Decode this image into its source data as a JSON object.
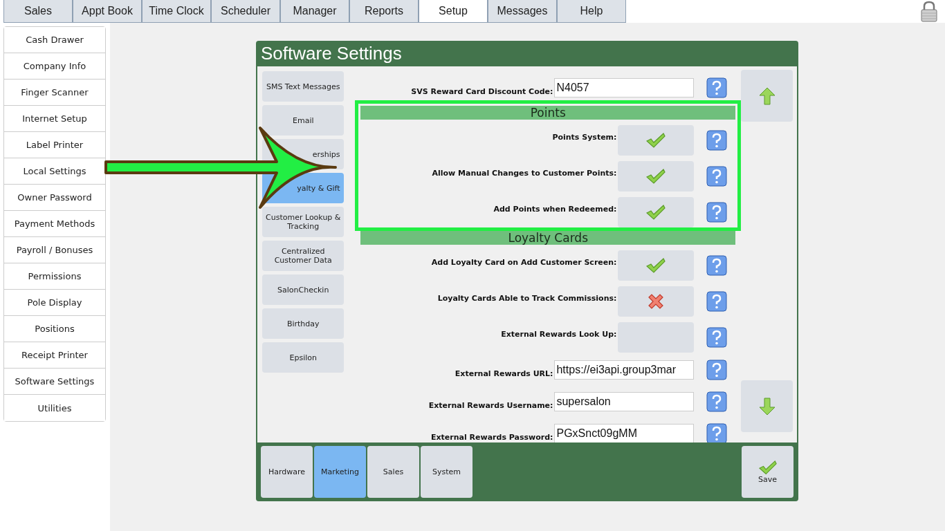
{
  "top_tabs": [
    {
      "label": "Sales",
      "selected": false
    },
    {
      "label": "Appt Book",
      "selected": false
    },
    {
      "label": "Time Clock",
      "selected": false
    },
    {
      "label": "Scheduler",
      "selected": false
    },
    {
      "label": "Manager",
      "selected": false
    },
    {
      "label": "Reports",
      "selected": false
    },
    {
      "label": "Setup",
      "selected": true
    },
    {
      "label": "Messages",
      "selected": false
    },
    {
      "label": "Help",
      "selected": false
    }
  ],
  "sidebar": {
    "items": [
      {
        "label": "Cash Drawer",
        "selected": false
      },
      {
        "label": "Company Info",
        "selected": false
      },
      {
        "label": "Finger Scanner",
        "selected": false
      },
      {
        "label": "Internet Setup",
        "selected": false
      },
      {
        "label": "Label Printer",
        "selected": false
      },
      {
        "label": "Local Settings",
        "selected": false
      },
      {
        "label": "Owner Password",
        "selected": false
      },
      {
        "label": "Payment Methods",
        "selected": false
      },
      {
        "label": "Payroll / Bonuses",
        "selected": false
      },
      {
        "label": "Permissions",
        "selected": false
      },
      {
        "label": "Pole Display",
        "selected": false
      },
      {
        "label": "Positions",
        "selected": false
      },
      {
        "label": "Receipt Printer",
        "selected": false
      },
      {
        "label": "Software Settings",
        "selected": false
      },
      {
        "label": "Utilities",
        "selected": false
      }
    ]
  },
  "dialog": {
    "title": "Software Settings",
    "categories": [
      {
        "label": "SMS Text Messages",
        "selected": false
      },
      {
        "label": "Email",
        "selected": false
      },
      {
        "label": "erships",
        "selected": false,
        "kind": "partial"
      },
      {
        "label": "yalty & Gift",
        "selected": true,
        "kind": "partial"
      },
      {
        "label": "Customer Lookup & Tracking",
        "selected": false
      },
      {
        "label": "Centralized Customer Data",
        "selected": false
      },
      {
        "label": "SalonCheckin",
        "selected": false
      },
      {
        "label": "Birthday",
        "selected": false
      },
      {
        "label": "Epsilon",
        "selected": false
      }
    ],
    "sections": [
      {
        "highlighted": false,
        "rows": [
          {
            "kind": "field",
            "label": "SVS Reward Card Discount Code:",
            "value": "N4057"
          }
        ]
      },
      {
        "heading": "Points",
        "highlighted": true,
        "rows": [
          {
            "kind": "toggle",
            "label": "Points System:",
            "checked": true
          },
          {
            "kind": "toggle",
            "label": "Allow Manual Changes to Customer Points:",
            "checked": true
          },
          {
            "kind": "toggle",
            "label": "Add Points when Redeemed:",
            "checked": true
          }
        ]
      },
      {
        "heading": "Loyalty Cards",
        "highlighted": false,
        "rows": [
          {
            "kind": "toggle",
            "label": "Add Loyalty Card on Add Customer Screen:",
            "checked": true
          },
          {
            "kind": "toggle",
            "label": "Loyalty Cards Able to Track Commissions:",
            "checked": false
          },
          {
            "kind": "blank",
            "label": "External Rewards Look Up:"
          },
          {
            "kind": "field",
            "label": "External Rewards URL:",
            "value": "https://ei3api.group3mar"
          },
          {
            "kind": "field",
            "label": "External Rewards Username:",
            "value": "supersalon"
          },
          {
            "kind": "field",
            "label": "External Rewards Password:",
            "value": "PGxSnct09gMM"
          }
        ]
      }
    ],
    "groups": [
      {
        "label": "Hardware",
        "selected": false
      },
      {
        "label": "Marketing",
        "selected": true
      },
      {
        "label": "Sales",
        "selected": false
      },
      {
        "label": "System",
        "selected": false
      }
    ],
    "save_button": "Save"
  },
  "annotations": [
    {
      "kind": "arrow"
    }
  ]
}
